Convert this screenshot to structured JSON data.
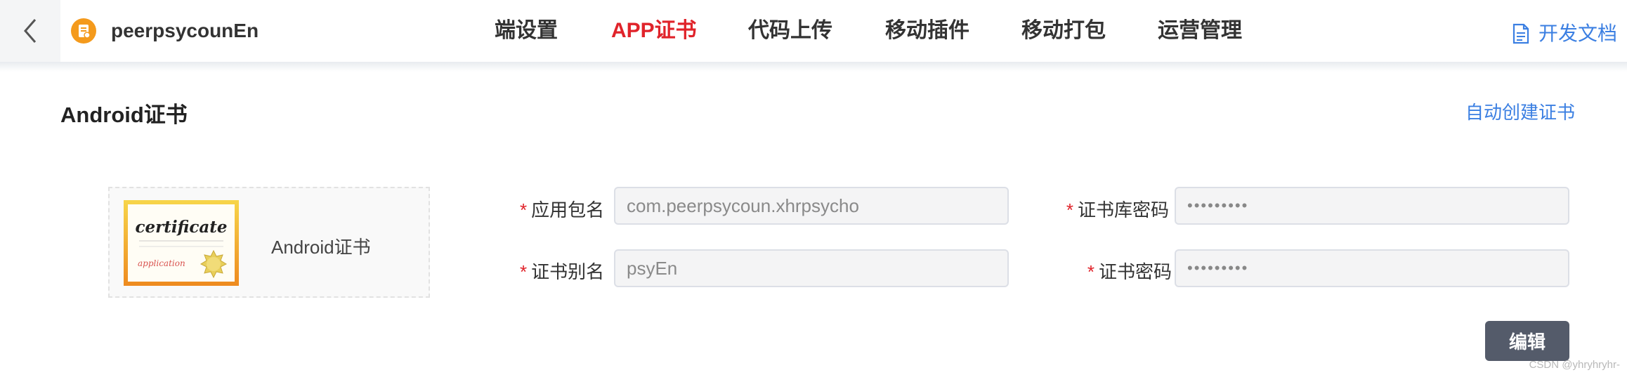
{
  "header": {
    "app_name": "peerpsycounEn",
    "nav": [
      {
        "label": "端设置",
        "active": false
      },
      {
        "label": "APP证书",
        "active": true
      },
      {
        "label": "代码上传",
        "active": false
      },
      {
        "label": "移动插件",
        "active": false
      },
      {
        "label": "移动打包",
        "active": false
      },
      {
        "label": "运营管理",
        "active": false
      }
    ],
    "dev_docs_label": "开发文档"
  },
  "section": {
    "title": "Android证书",
    "auto_create_label": "自动创建证书"
  },
  "certificate": {
    "label": "Android证书",
    "image_text_main": "certificate",
    "image_text_sub": "application"
  },
  "form": {
    "required_mark": "*",
    "package_name": {
      "label": "应用包名",
      "value": "com.peerpsycoun.xhrpsycho"
    },
    "alias": {
      "label": "证书别名",
      "value": "psyEn"
    },
    "keystore_password": {
      "label": "证书库密码",
      "value": "•••••••••"
    },
    "cert_password": {
      "label": "证书密码",
      "value": "•••••••••"
    }
  },
  "actions": {
    "edit_label": "编辑"
  },
  "watermark": "CSDN @yhryhryhr-",
  "colors": {
    "accent": "#3b7fe2",
    "active_nav": "#e0232a",
    "edit_button": "#545b6a"
  }
}
